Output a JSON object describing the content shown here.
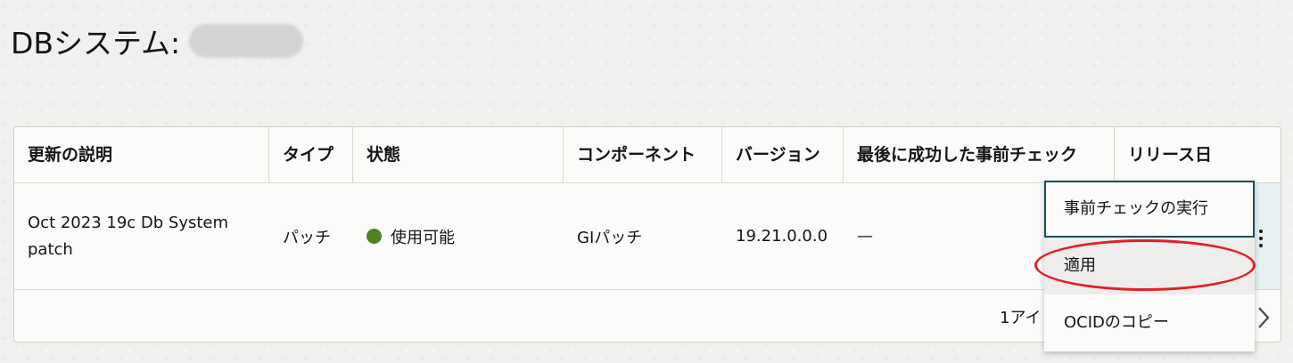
{
  "page": {
    "title": "DBシステム:"
  },
  "table": {
    "columns": [
      "更新の説明",
      "タイプ",
      "状態",
      "コンポーネント",
      "バージョン",
      "最後に成功した事前チェック",
      "リリース日"
    ],
    "rows": [
      {
        "description": "Oct 2023 19c Db System patch",
        "type": "パッチ",
        "status": "使用可能",
        "component": "GIパッチ",
        "version": "19.21.0.0.0",
        "last_precheck": "—"
      }
    ],
    "footer_text": "1アイ"
  },
  "menu": {
    "items": [
      "事前チェックの実行",
      "適用",
      "OCIDのコピー"
    ]
  },
  "colors": {
    "status_available": "#508223",
    "highlight": "#e0202a",
    "focus_border": "#1d4e5c"
  },
  "icons": {
    "kebab": "kebab-menu-icon",
    "next": "chevron-right-icon",
    "status": "status-dot-icon"
  }
}
